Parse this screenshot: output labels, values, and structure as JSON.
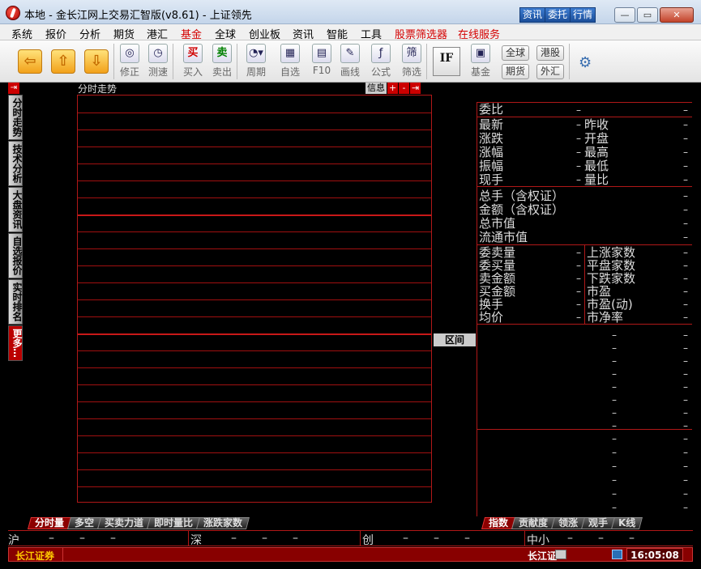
{
  "window": {
    "title": "本地 - 金长江网上交易汇智版(v8.61) - 上证领先",
    "links": [
      "资讯",
      "委托",
      "行情"
    ],
    "controls": [
      "—",
      "▭",
      "✕"
    ]
  },
  "menu": [
    {
      "label": "系统",
      "red": false
    },
    {
      "label": "报价",
      "red": false
    },
    {
      "label": "分析",
      "red": false
    },
    {
      "label": "期货",
      "red": false
    },
    {
      "label": "港汇",
      "red": false
    },
    {
      "label": "基金",
      "red": true
    },
    {
      "label": "全球",
      "red": false
    },
    {
      "label": "创业板",
      "red": false
    },
    {
      "label": "资讯",
      "red": false
    },
    {
      "label": "智能",
      "red": false
    },
    {
      "label": "工具",
      "red": false
    },
    {
      "label": "股票筛选器",
      "red": true
    },
    {
      "label": "在线服务",
      "red": true
    }
  ],
  "toolbar": {
    "buttons": [
      {
        "label": "修正",
        "glyph": "◎",
        "icon": "refresh-icon"
      },
      {
        "label": "测速",
        "glyph": "◷",
        "icon": "clock-icon"
      },
      {
        "label": "买入",
        "glyph": "买",
        "icon": "buy-icon",
        "color": "#d00000"
      },
      {
        "label": "卖出",
        "glyph": "卖",
        "icon": "sell-icon",
        "color": "#008000"
      },
      {
        "label": "周期",
        "glyph": "◔▾",
        "icon": "period-icon"
      },
      {
        "label": "自选",
        "glyph": "▦",
        "icon": "favorites-icon"
      },
      {
        "label": "F10",
        "glyph": "▤",
        "icon": "f10-icon"
      },
      {
        "label": "画线",
        "glyph": "✎",
        "icon": "draw-line-icon"
      },
      {
        "label": "公式",
        "glyph": "ƒ",
        "icon": "formula-icon"
      },
      {
        "label": "筛选",
        "glyph": "筛",
        "icon": "filter-icon"
      }
    ],
    "if_label": "IF",
    "fund_label": "基金",
    "market_buttons": [
      "全球",
      "港股",
      "期货",
      "外汇"
    ]
  },
  "left_tabs": [
    "分时走势",
    "技术分析",
    "大盘资讯",
    "自选报价",
    "实时排名",
    "更多…"
  ],
  "chart": {
    "title": "分时走势",
    "header_buttons": [
      "信息",
      "+",
      "-",
      "⇥"
    ],
    "range_button": "区间"
  },
  "quote": {
    "wei_bi": {
      "label": "委比",
      "value": "–"
    },
    "pairs": [
      {
        "left": "最新",
        "right": "昨收"
      },
      {
        "left": "涨跌",
        "right": "开盘"
      },
      {
        "left": "涨幅",
        "right": "最高"
      },
      {
        "left": "振幅",
        "right": "最低"
      },
      {
        "left": "现手",
        "right": "量比"
      }
    ],
    "totals": [
      "总手（含权证）",
      "金额（含权证）",
      "总市值",
      "流通市值"
    ],
    "stats": [
      {
        "left": "委卖量",
        "right": "上涨家数"
      },
      {
        "left": "委买量",
        "right": "平盘家数"
      },
      {
        "left": "卖金额",
        "right": "下跌家数"
      },
      {
        "left": "买金额",
        "right": "市盈"
      },
      {
        "left": "换手",
        "right": "市盈(动)"
      },
      {
        "left": "均价",
        "right": "市净率"
      }
    ]
  },
  "bottom_tabs_left": [
    "分时量",
    "多空",
    "买卖力道",
    "即时量比",
    "涨跌家数"
  ],
  "bottom_tabs_right": [
    "指数",
    "贡献度",
    "领涨",
    "观手",
    "K线"
  ],
  "index_bar": [
    {
      "name": "沪",
      "values": [
        "–",
        "–",
        "–"
      ]
    },
    {
      "name": "深",
      "values": [
        "–",
        "–",
        "–"
      ]
    },
    {
      "name": "创",
      "values": [
        "–",
        "–",
        "–"
      ]
    },
    {
      "name": "中小",
      "values": [
        "–",
        "–",
        "–"
      ]
    }
  ],
  "status": {
    "broker": "长江证券",
    "mid": "长江证",
    "time": "16:05:08"
  }
}
